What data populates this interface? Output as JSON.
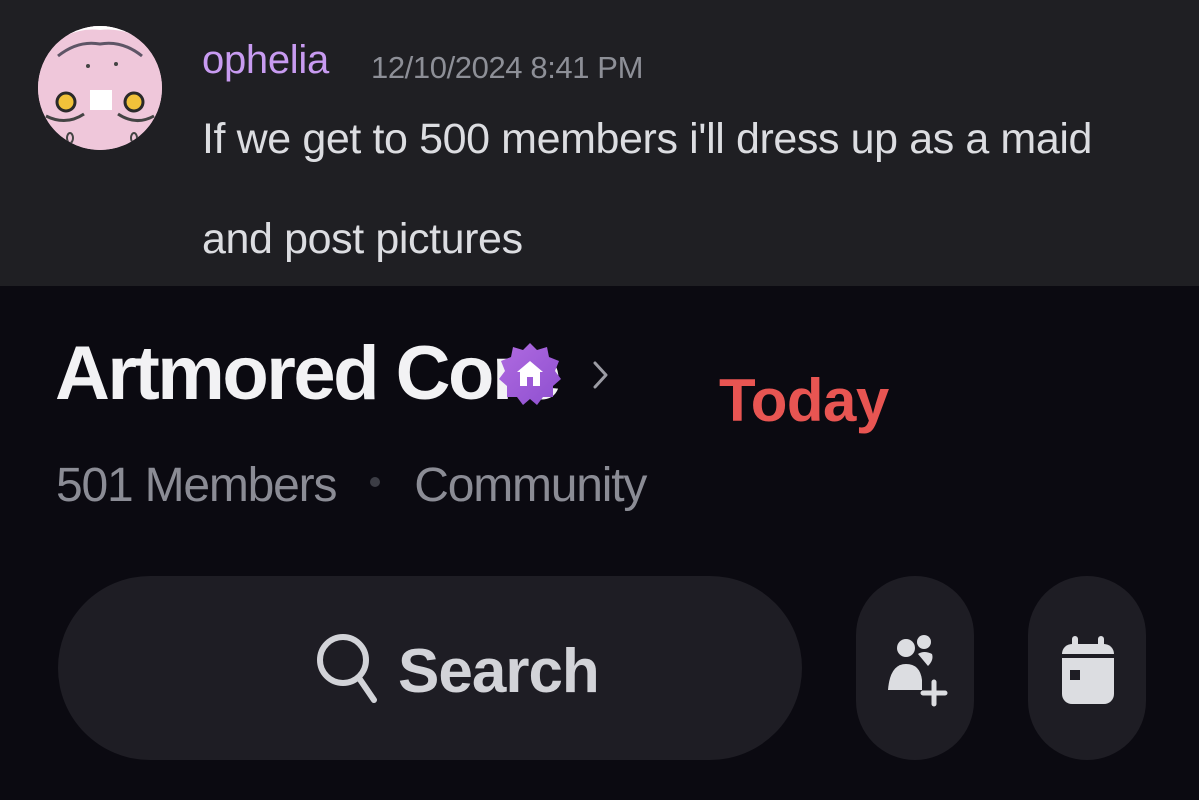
{
  "message": {
    "username": "ophelia",
    "timestamp": "12/10/2024 8:41 PM",
    "text_line1": "If we get to 500 members i'll dress up as a maid",
    "text_line2": "and post pictures",
    "username_color": "#c89bf1"
  },
  "server": {
    "name": "Artmored Core",
    "badge_icon": "community-house-badge-icon",
    "member_count": "501 Members",
    "type": "Community"
  },
  "overlay": {
    "text": "Today",
    "color": "#e85552"
  },
  "actions": {
    "search_label": "Search",
    "invite_icon": "add-member-icon",
    "events_icon": "calendar-icon"
  }
}
